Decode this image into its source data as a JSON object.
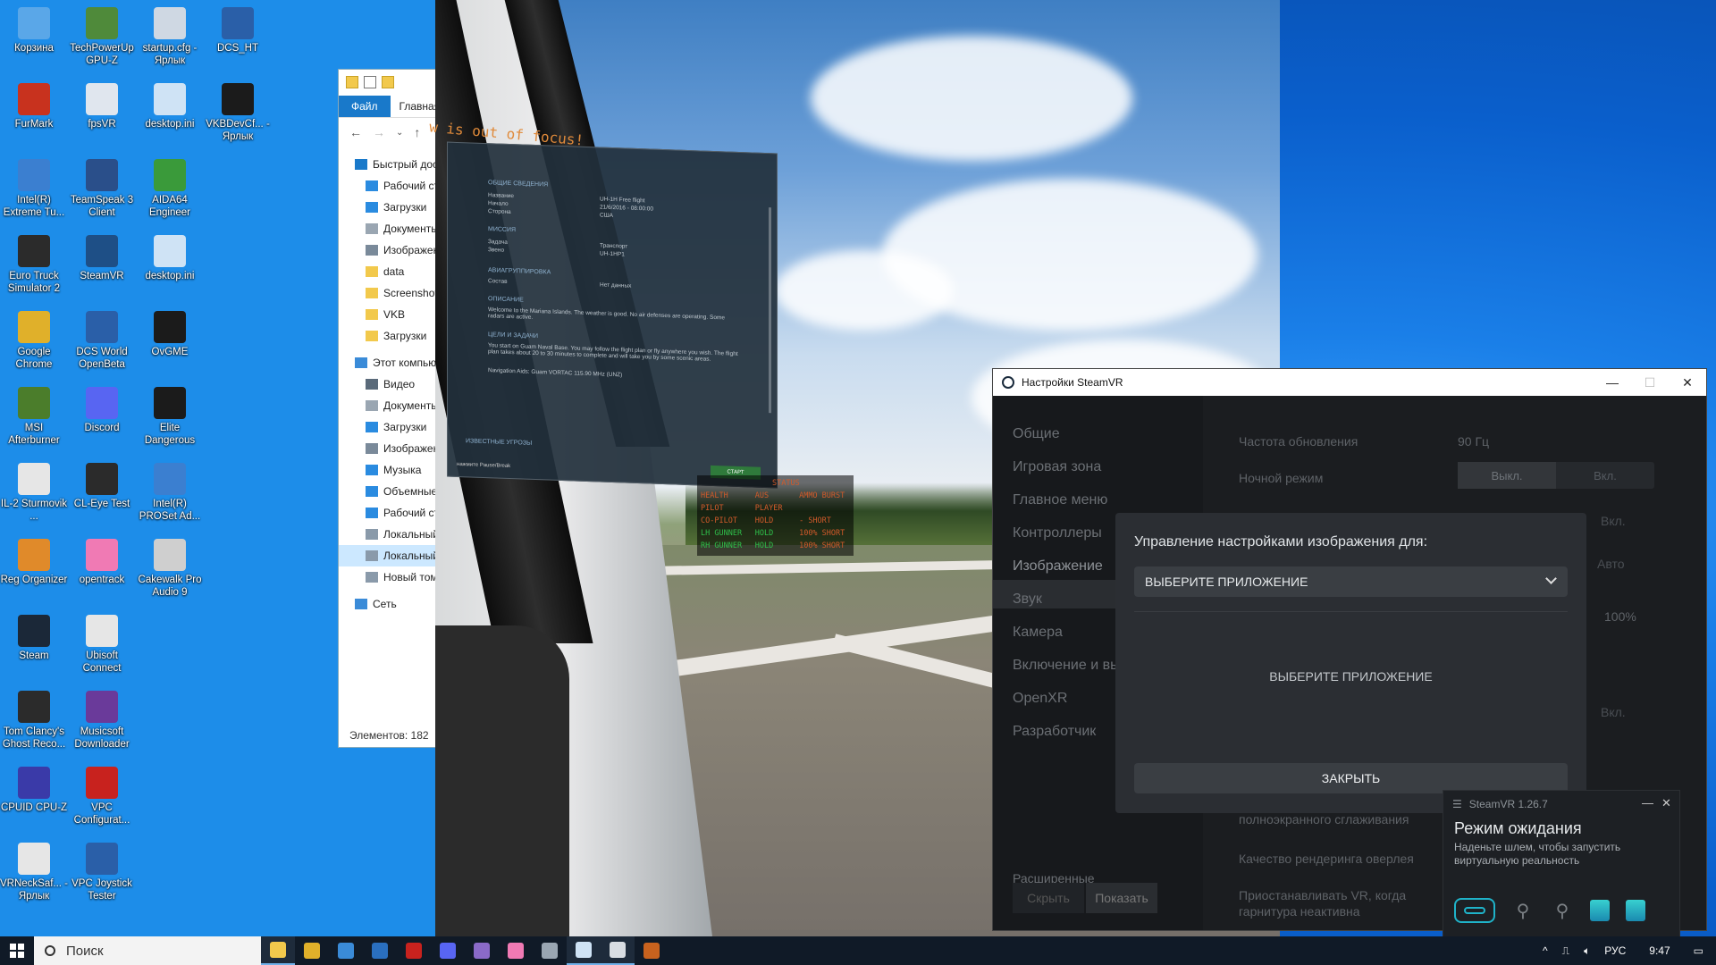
{
  "desktop": {
    "icons": [
      {
        "label": "Корзина",
        "icon": "recycle-bin-icon",
        "color": "#5aa7e8"
      },
      {
        "label": "TechPowerUp GPU-Z",
        "icon": "gpuz-icon",
        "color": "#4f8a3a"
      },
      {
        "label": "startup.cfg - Ярлык",
        "icon": "file-icon",
        "color": "#cfd8e3"
      },
      {
        "label": "DCS_HT",
        "icon": "dcs-icon",
        "color": "#2a5fa8"
      },
      {
        "label": "FurMark",
        "icon": "furmark-icon",
        "color": "#c8321e"
      },
      {
        "label": "fpsVR",
        "icon": "fpsvr-icon",
        "color": "#e0e6ee"
      },
      {
        "label": "desktop.ini",
        "icon": "file-icon",
        "color": "#cfe3f5"
      },
      {
        "label": "VKBDevCf... - Ярлык",
        "icon": "vkb-icon",
        "color": "#1b1b1b"
      },
      {
        "label": "Intel(R) Extreme Tu...",
        "icon": "intel-xtu-icon",
        "color": "#3b7fd0"
      },
      {
        "label": "TeamSpeak 3 Client",
        "icon": "teamspeak-icon",
        "color": "#2a4f8a"
      },
      {
        "label": "AIDA64 Engineer",
        "icon": "aida64-icon",
        "color": "#3a9a3a"
      },
      {
        "label": "Euro Truck Simulator 2",
        "icon": "ets2-icon",
        "color": "#2b2b2b"
      },
      {
        "label": "SteamVR",
        "icon": "steamvr-icon",
        "color": "#1e4f86"
      },
      {
        "label": "desktop.ini",
        "icon": "file-icon",
        "color": "#cfe3f5"
      },
      {
        "label": "Google Chrome",
        "icon": "chrome-icon",
        "color": "#e0b02a"
      },
      {
        "label": "DCS World OpenBeta",
        "icon": "dcs-icon",
        "color": "#2a5fa8"
      },
      {
        "label": "OvGME",
        "icon": "ovgme-icon",
        "color": "#1b1b1b"
      },
      {
        "label": "MSI Afterburner",
        "icon": "afterburner-icon",
        "color": "#4b7d2b"
      },
      {
        "label": "Discord",
        "icon": "discord-icon",
        "color": "#5865f2"
      },
      {
        "label": "Elite Dangerous",
        "icon": "elite-icon",
        "color": "#1b1b1b"
      },
      {
        "label": "IL-2 Sturmovik ...",
        "icon": "il2-icon",
        "color": "#e6e6e6"
      },
      {
        "label": "CL-Eye Test",
        "icon": "cleye-icon",
        "color": "#2b2b2b"
      },
      {
        "label": "Intel(R) PROSet Ad...",
        "icon": "intel-proset-icon",
        "color": "#3b7fd0"
      },
      {
        "label": "Reg Organizer",
        "icon": "reg-organizer-icon",
        "color": "#e08a2a"
      },
      {
        "label": "opentrack",
        "icon": "opentrack-icon",
        "color": "#f07ab4"
      },
      {
        "label": "Cakewalk Pro Audio 9",
        "icon": "cakewalk-icon",
        "color": "#cfcfcf"
      },
      {
        "label": "Steam",
        "icon": "steam-icon",
        "color": "#1b2838"
      },
      {
        "label": "Ubisoft Connect",
        "icon": "ubisoft-icon",
        "color": "#e6e6e6"
      },
      {
        "label": "Tom Clancy's Ghost Reco...",
        "icon": "ghost-recon-icon",
        "color": "#2b2b2b"
      },
      {
        "label": "Musicsoft Downloader",
        "icon": "musicsoft-icon",
        "color": "#6a3a9a"
      },
      {
        "label": "CPUID CPU-Z",
        "icon": "cpuz-icon",
        "color": "#3a3aa8"
      },
      {
        "label": "VPC Configurat...",
        "icon": "vpc-icon",
        "color": "#c8221e"
      },
      {
        "label": "VRNeckSaf... - Ярлык",
        "icon": "vrnecksafer-icon",
        "color": "#e6e6e6"
      },
      {
        "label": "VPC Joystick Tester",
        "icon": "vpc-tester-icon",
        "color": "#2a5fa8"
      }
    ]
  },
  "explorer": {
    "tab_file": "Файл",
    "tab_home": "Главная",
    "tree": [
      {
        "label": "Быстрый доступ",
        "icon": "star-icon",
        "color": "#1979ca"
      },
      {
        "label": "Рабочий стол",
        "icon": "desktop-folder-icon",
        "color": "#2a8be0"
      },
      {
        "label": "Загрузки",
        "icon": "download-icon",
        "color": "#2a8be0"
      },
      {
        "label": "Документы",
        "icon": "documents-icon",
        "color": "#9aa6b2"
      },
      {
        "label": "Изображения",
        "icon": "pictures-icon",
        "color": "#7a8a9a"
      },
      {
        "label": "data",
        "icon": "folder-icon",
        "color": "#f2c94c"
      },
      {
        "label": "Screenshots",
        "icon": "folder-icon",
        "color": "#f2c94c"
      },
      {
        "label": "VKB",
        "icon": "folder-icon",
        "color": "#f2c94c"
      },
      {
        "label": "Загрузки",
        "icon": "folder-icon",
        "color": "#f2c94c"
      },
      {
        "label": "Этот компьютер",
        "icon": "computer-icon",
        "color": "#3a8bd8"
      },
      {
        "label": "Видео",
        "icon": "video-icon",
        "color": "#5a6a7a"
      },
      {
        "label": "Документы",
        "icon": "documents-icon",
        "color": "#9aa6b2"
      },
      {
        "label": "Загрузки",
        "icon": "download-icon",
        "color": "#2a8be0"
      },
      {
        "label": "Изображения",
        "icon": "pictures-icon",
        "color": "#7a8a9a"
      },
      {
        "label": "Музыка",
        "icon": "music-icon",
        "color": "#2a8be0"
      },
      {
        "label": "Объемные объекты",
        "icon": "3d-objects-icon",
        "color": "#2a8be0"
      },
      {
        "label": "Рабочий стол",
        "icon": "desktop-folder-icon",
        "color": "#2a8be0"
      },
      {
        "label": "Локальный диск",
        "icon": "drive-icon",
        "color": "#8a9aaa"
      },
      {
        "label": "Локальный диск",
        "icon": "drive-icon",
        "color": "#8a9aaa"
      },
      {
        "label": "Новый том",
        "icon": "drive-icon",
        "color": "#8a9aaa"
      },
      {
        "label": "Сеть",
        "icon": "network-icon",
        "color": "#3a8bd8"
      }
    ],
    "status": "Элементов: 182"
  },
  "game": {
    "out_of_focus": "w is out of focus!",
    "briefing": {
      "section_general": "Общие сведения",
      "rows": [
        {
          "label": "Название",
          "value": "UH-1H Free flight"
        },
        {
          "label": "Начало",
          "value": "21/6/2016 - 08:00:00"
        },
        {
          "label": "Сторона",
          "value": "США"
        }
      ],
      "section_mission": "Миссия",
      "mission_rows": [
        {
          "label": "Задача",
          "value": "Транспорт"
        },
        {
          "label": "Звено",
          "value": "UH-1HP1"
        }
      ],
      "section_group": "Авиагруппировка",
      "group_rows": [
        {
          "label": "Состав",
          "value": "Нет данных"
        }
      ],
      "section_desc": "Описание",
      "desc_text": "Welcome to the Mariana Islands. The weather is good. No air defenses are operating. Some radars are active.",
      "section_goals": "Цели и задачи",
      "goals_text": "You start on Guam Naval Base. You may follow the flight plan or fly anywhere you wish. The flight plan takes about 20 to 30 minutes to complete and will take you by some scenic areas.",
      "nav_aids": "Navigation Aids: Guam VORTAC 115.90 MHz (UNZ)",
      "section_threats": "Известные угрозы",
      "hint": "нажмите Pause/Break",
      "start": "СТАРТ"
    },
    "crew": {
      "header": "STATUS",
      "rows": [
        {
          "role": "HEALTH",
          "mode": "AUS",
          "status": "AMMO BURST",
          "ok": false
        },
        {
          "role": "PILOT",
          "mode": "PLAYER",
          "status": "",
          "ok": false
        },
        {
          "role": "CO-PILOT",
          "mode": "HOLD",
          "status": "- SHORT",
          "ok": false
        },
        {
          "role": "LH GUNNER",
          "mode": "HOLD",
          "status": "100% SHORT",
          "ok": true
        },
        {
          "role": "RH GUNNER",
          "mode": "HOLD",
          "status": "100% SHORT",
          "ok": true
        }
      ]
    }
  },
  "steamvr_settings": {
    "title": "Настройки SteamVR",
    "nav": [
      "Общие",
      "Игровая зона",
      "Главное меню",
      "Контроллеры",
      "Изображение",
      "Звук",
      "Камера",
      "Включение и выключение",
      "OpenXR",
      "Разработчик"
    ],
    "active_nav_index": 4,
    "advanced_label": "Расширенные настройки",
    "hide_btn": "Скрыть",
    "show_btn": "Показать",
    "settings": [
      {
        "label": "Частота обновления",
        "value": "90 Гц"
      },
      {
        "label": "Ночной режим",
        "off": "Выкл.",
        "on": "Вкл."
      }
    ],
    "hidden_values": {
      "vkl1": "Вкл.",
      "auto": "Авто",
      "percent": "100%",
      "vkl2": "Вкл."
    },
    "lower_settings": [
      "полноэкранного сглаживания",
      "Качество рендеринга оверлея",
      "Приостанавливать VR, когда гарнитура неактивна"
    ]
  },
  "modal": {
    "title": "Управление настройками изображения для:",
    "select_value": "ВЫБЕРИТЕ ПРИЛОЖЕНИЕ",
    "placeholder": "ВЫБЕРИТЕ ПРИЛОЖЕНИЕ",
    "close": "ЗАКРЫТЬ"
  },
  "steamvr_status": {
    "version": "SteamVR 1.26.7",
    "state": "Режим ожидания",
    "description": "Наденьте шлем, чтобы запустить виртуальную реальность",
    "accent": "#1fb3c9"
  },
  "taskbar": {
    "search_placeholder": "Поиск",
    "apps": [
      {
        "name": "explorer",
        "color": "#f2c94c"
      },
      {
        "name": "chrome",
        "color": "#e0b02a"
      },
      {
        "name": "app-blue",
        "color": "#3a8bd8"
      },
      {
        "name": "teamspeak",
        "color": "#2a6fbf"
      },
      {
        "name": "app-red",
        "color": "#c8221e"
      },
      {
        "name": "discord",
        "color": "#5865f2"
      },
      {
        "name": "opentrack-tray",
        "color": "#8a6ac8"
      },
      {
        "name": "opentrack",
        "color": "#f07ab4"
      },
      {
        "name": "app-grey",
        "color": "#9aa6b2"
      },
      {
        "name": "app-files",
        "color": "#cfe3f5"
      },
      {
        "name": "steamvr",
        "color": "#d8dde2"
      },
      {
        "name": "dcs",
        "color": "#c8621e"
      }
    ],
    "lang": "РУС",
    "time": "9:47"
  }
}
